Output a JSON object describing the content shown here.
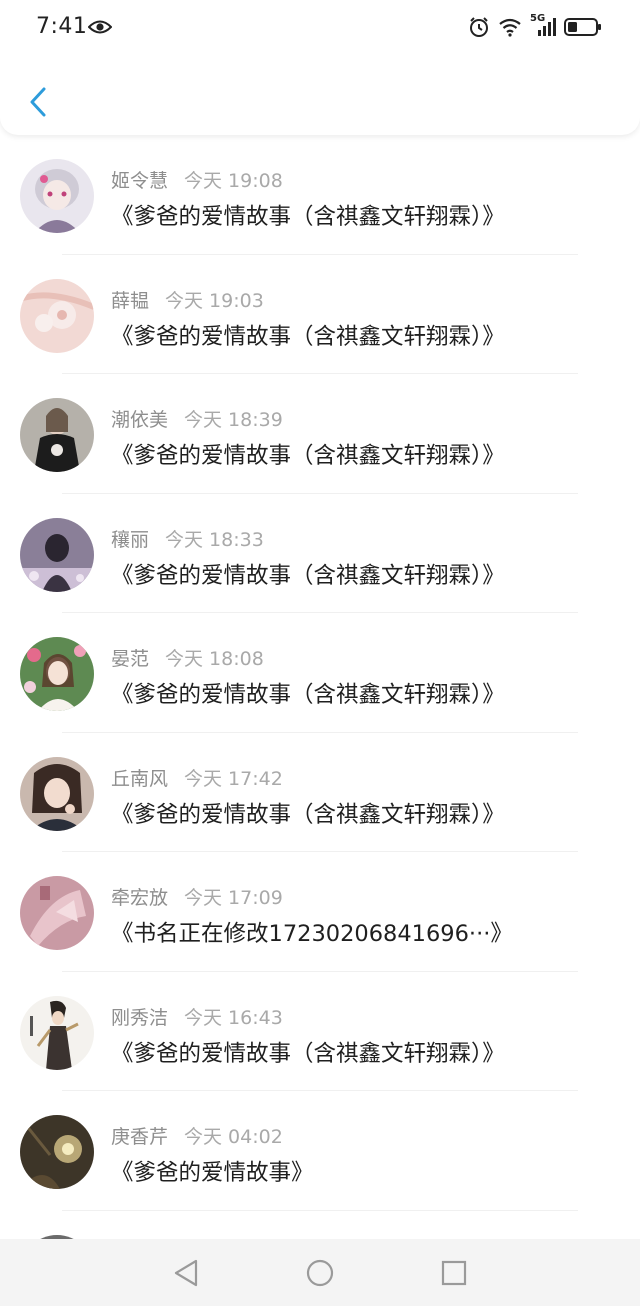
{
  "status_bar": {
    "time": "7:41",
    "network": "5G"
  },
  "header": {
    "back_icon": "chevron-left-icon",
    "accent_color": "#2d9cdb"
  },
  "items": [
    {
      "name": "姬令慧",
      "time": "今天 19:08",
      "message": "《爹爸的爱情故事（含祺鑫文轩翔霖）》"
    },
    {
      "name": "薛韫",
      "time": "今天 19:03",
      "message": "《爹爸的爱情故事（含祺鑫文轩翔霖）》"
    },
    {
      "name": "潮依美",
      "time": "今天 18:39",
      "message": "《爹爸的爱情故事（含祺鑫文轩翔霖）》"
    },
    {
      "name": "穰丽",
      "time": "今天 18:33",
      "message": "《爹爸的爱情故事（含祺鑫文轩翔霖）》"
    },
    {
      "name": "晏范",
      "time": "今天 18:08",
      "message": "《爹爸的爱情故事（含祺鑫文轩翔霖）》"
    },
    {
      "name": "丘南风",
      "time": "今天 17:42",
      "message": "《爹爸的爱情故事（含祺鑫文轩翔霖）》"
    },
    {
      "name": "牵宏放",
      "time": "今天 17:09",
      "message": "《书名正在修改17230206841696···》"
    },
    {
      "name": "刚秀洁",
      "time": "今天 16:43",
      "message": "《爹爸的爱情故事（含祺鑫文轩翔霖）》"
    },
    {
      "name": "庚香芹",
      "time": "今天 04:02",
      "message": "《爹爸的爱情故事》"
    }
  ]
}
